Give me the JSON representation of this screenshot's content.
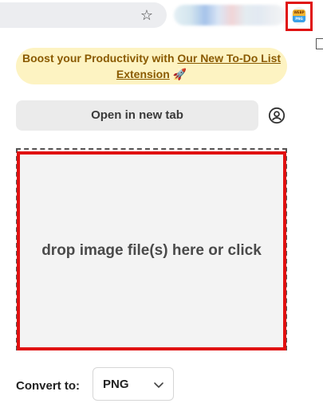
{
  "browser": {
    "bookmark_icon": "star-icon",
    "extension_icon": {
      "name": "webp-to-png-extension-icon",
      "top_text": "WEBP",
      "bottom_text": "PNG"
    },
    "highlight_color": "#e01010"
  },
  "popup": {
    "promo": {
      "prefix": "Boost your Productivity with ",
      "link_text": "Our New To-Do List Extension",
      "suffix": " 🚀",
      "background": "#fdf3c2"
    },
    "open_tab_label": "Open in new tab",
    "account_icon": "account-circle-icon",
    "dropzone_text": "drop image file(s) here or click",
    "convert_label": "Convert to:",
    "format": {
      "selected": "PNG"
    }
  }
}
